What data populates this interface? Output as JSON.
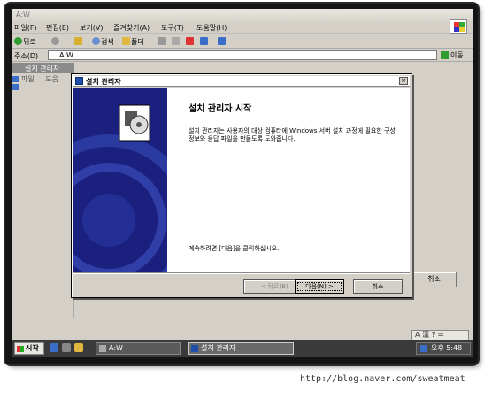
{
  "explorer": {
    "title": "A:W",
    "menu": [
      "파일(F)",
      "편집(E)",
      "보기(V)",
      "즐겨찾기(A)",
      "도구(T)",
      "도움말(H)"
    ],
    "toolbar": {
      "back": "뒤로",
      "search": "검색",
      "folders": "폴더"
    },
    "address_label": "주소(D)",
    "address_value": "A:W",
    "go_label": "이동"
  },
  "child_window": {
    "title": "설치 관리자",
    "menu": [
      "파일",
      "도움"
    ],
    "cancel_label": "취소"
  },
  "dialog": {
    "title": "설치 관리자",
    "close": "×",
    "heading": "설치 관리자 시작",
    "description": "설치 관리자는 사용자의 대상 컴퓨터에 Windows 서버 설치 과정에 필요한 구성 정보와 응답 파일을 만들도록 도와줍니다.",
    "hint": "계속하려면 [다음]을 클릭하십시오.",
    "back_label": "< 뒤로(B)",
    "next_label": "다음(N) >",
    "cancel_label": "취소"
  },
  "taskbar": {
    "start_label": "시작",
    "tasks": [
      "A:W",
      "설치 관리자"
    ],
    "clock": "오후 5:48",
    "langbar": "A 漢 ? ="
  },
  "watermark": "http://blog.naver.com/sweatmeat",
  "colors": {
    "banner": "#1b1f7e",
    "frame": "#141414",
    "face": "#d4d0c8"
  }
}
